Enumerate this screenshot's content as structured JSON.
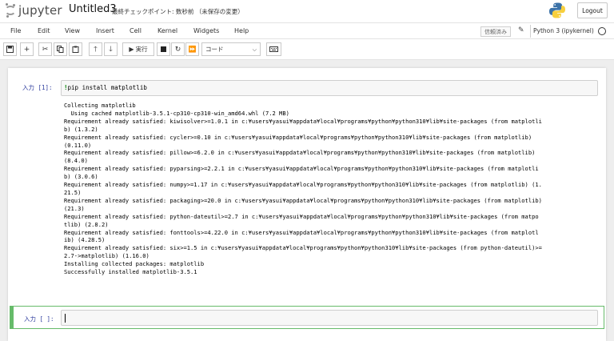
{
  "header": {
    "logo_text": "jupyter",
    "notebook_title": "Untitled3",
    "checkpoint": "最終チェックポイント: 数秒前 （未保存の変更）",
    "logout_label": "Logout"
  },
  "menubar": {
    "items": [
      "File",
      "Edit",
      "View",
      "Insert",
      "Cell",
      "Kernel",
      "Widgets",
      "Help"
    ],
    "trusted_label": "信頼済み",
    "kernel_label": "Python 3 (ipykernel)"
  },
  "toolbar": {
    "run_label": "実行",
    "cell_type": "コード",
    "icons": [
      "save-icon",
      "plus-icon",
      "cut-icon",
      "copy-icon",
      "paste-icon",
      "arrow-up-icon",
      "arrow-down-icon",
      "run-icon",
      "stop-icon",
      "restart-icon",
      "fast-forward-icon",
      "keyboard-icon"
    ]
  },
  "cells": [
    {
      "prompt": "入力 [1]:",
      "code_magic": "!",
      "code_rest": "pip install matplotlib",
      "output_lines": [
        "Collecting matplotlib",
        "  Using cached matplotlib-3.5.1-cp310-cp310-win_amd64.whl (7.2 MB)",
        "Requirement already satisfied: kiwisolver>=1.0.1 in c:¥users¥yasui¥appdata¥local¥programs¥python¥python310¥lib¥site-packages (from matplotli",
        "b) (1.3.2)",
        "Requirement already satisfied: cycler>=0.10 in c:¥users¥yasui¥appdata¥local¥programs¥python¥python310¥lib¥site-packages (from matplotlib)",
        "(0.11.0)",
        "Requirement already satisfied: pillow>=6.2.0 in c:¥users¥yasui¥appdata¥local¥programs¥python¥python310¥lib¥site-packages (from matplotlib)",
        "(8.4.0)",
        "Requirement already satisfied: pyparsing>=2.2.1 in c:¥users¥yasui¥appdata¥local¥programs¥python¥python310¥lib¥site-packages (from matplotli",
        "b) (3.0.6)",
        "Requirement already satisfied: numpy>=1.17 in c:¥users¥yasui¥appdata¥local¥programs¥python¥python310¥lib¥site-packages (from matplotlib) (1.",
        "21.5)",
        "Requirement already satisfied: packaging>=20.0 in c:¥users¥yasui¥appdata¥local¥programs¥python¥python310¥lib¥site-packages (from matplotlib)",
        "(21.3)",
        "Requirement already satisfied: python-dateutil>=2.7 in c:¥users¥yasui¥appdata¥local¥programs¥python¥python310¥lib¥site-packages (from matpo",
        "tlib) (2.8.2)",
        "Requirement already satisfied: fonttools>=4.22.0 in c:¥users¥yasui¥appdata¥local¥programs¥python¥python310¥lib¥site-packages (from matplotl",
        "ib) (4.28.5)",
        "Requirement already satisfied: six>=1.5 in c:¥users¥yasui¥appdata¥local¥programs¥python¥python310¥lib¥site-packages (from python-dateutil)>=",
        "2.7->matplotlib) (1.16.0)",
        "Installing collected packages: matplotlib",
        "Successfully installed matplotlib-3.5.1"
      ]
    },
    {
      "prompt": "入力 [ ]:"
    }
  ],
  "colors": {
    "prompt_blue": "#303f9f",
    "active_cell_green": "#66bb6a",
    "magic_green": "#008000"
  }
}
